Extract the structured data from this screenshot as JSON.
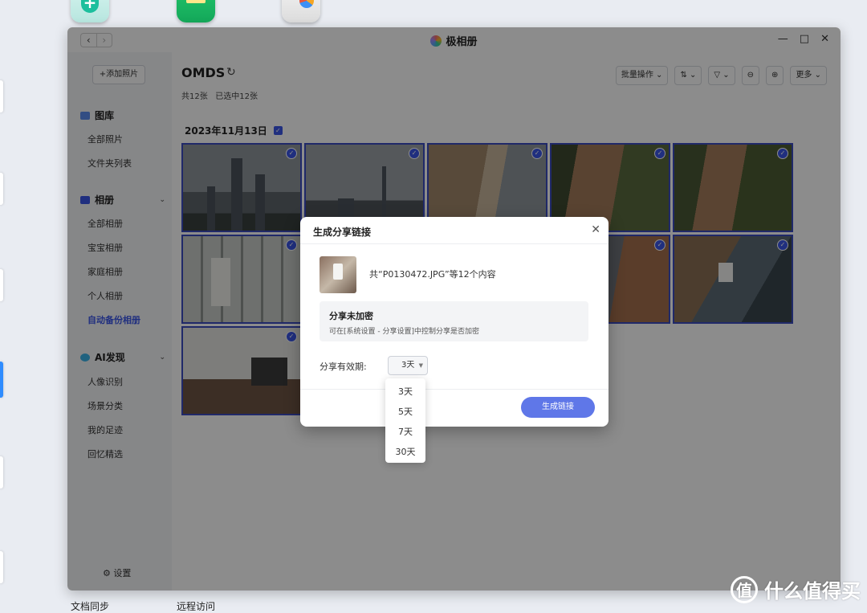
{
  "window": {
    "title": "极相册",
    "nav_back": "‹",
    "nav_forward": "›",
    "minimize": "—",
    "maximize": "□",
    "close": "✕"
  },
  "sidebar": {
    "add_photo": "+添加照片",
    "gallery": {
      "label": "图库",
      "items": [
        "全部照片",
        "文件夹列表"
      ]
    },
    "albums": {
      "label": "相册",
      "items": [
        "全部相册",
        "宝宝相册",
        "家庭相册",
        "个人相册",
        "自动备份相册"
      ],
      "active": "自动备份相册"
    },
    "ai": {
      "label": "AI发现",
      "items": [
        "人像识别",
        "场景分类",
        "我的足迹",
        "回忆精选"
      ]
    },
    "settings": "设置"
  },
  "main": {
    "title": "OMDS",
    "count_total": "共12张",
    "count_selected": "已选中12张",
    "date_group": "2023年11月13日",
    "toolbar": {
      "batch": "批量操作",
      "sort": "",
      "filter": "",
      "zoom_out": "⊖",
      "zoom_in": "⊕",
      "more": "更多"
    }
  },
  "dialog": {
    "title": "生成分享链接",
    "file_desc": "共“P0130472.JPG”等12个内容",
    "notice_title": "分享未加密",
    "notice_text": "可在[系统设置 - 分享设置]中控制分享是否加密",
    "validity_label": "分享有效期:",
    "validity_value": "3天",
    "generate_button": "生成链接",
    "options": [
      "3天",
      "5天",
      "7天",
      "30天"
    ]
  },
  "desktop": {
    "label_sync": "文档同步",
    "label_remote": "远程访问",
    "watermark": "什么值得买",
    "watermark_mark": "值"
  }
}
